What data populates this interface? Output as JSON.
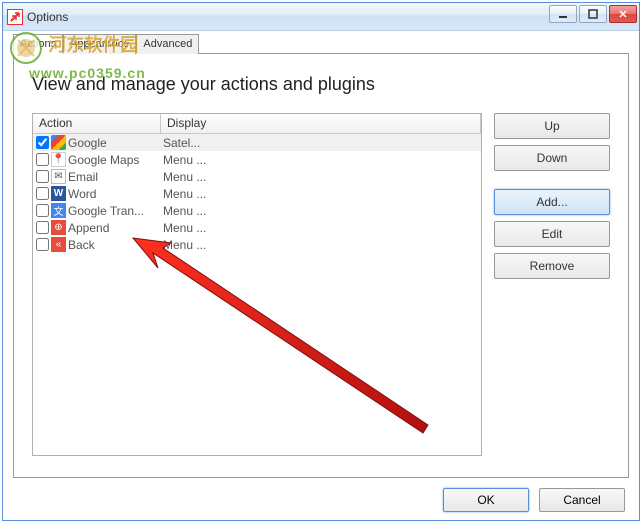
{
  "window": {
    "title": "Options"
  },
  "tabs": {
    "actions": "Actions",
    "appearance": "Appearance",
    "advanced": "Advanced"
  },
  "heading": "View and manage your actions and plugins",
  "table": {
    "headers": {
      "action": "Action",
      "display": "Display"
    },
    "rows": [
      {
        "checked": true,
        "icon": "google",
        "action": "Google",
        "display": "Satel..."
      },
      {
        "checked": false,
        "icon": "gmaps",
        "action": "Google Maps",
        "display": "Menu ..."
      },
      {
        "checked": false,
        "icon": "email",
        "action": "Email",
        "display": "Menu ..."
      },
      {
        "checked": false,
        "icon": "word",
        "action": "Word",
        "display": "Menu ..."
      },
      {
        "checked": false,
        "icon": "gtran",
        "action": "Google Tran...",
        "display": "Menu ..."
      },
      {
        "checked": false,
        "icon": "append",
        "action": "Append",
        "display": "Menu ..."
      },
      {
        "checked": false,
        "icon": "back",
        "action": "Back",
        "display": "Menu ..."
      }
    ]
  },
  "buttons": {
    "up": "Up",
    "down": "Down",
    "add": "Add...",
    "edit": "Edit",
    "remove": "Remove",
    "ok": "OK",
    "cancel": "Cancel"
  },
  "watermark": {
    "line1": "河东软件园",
    "line2": "www.pc0359.cn"
  }
}
